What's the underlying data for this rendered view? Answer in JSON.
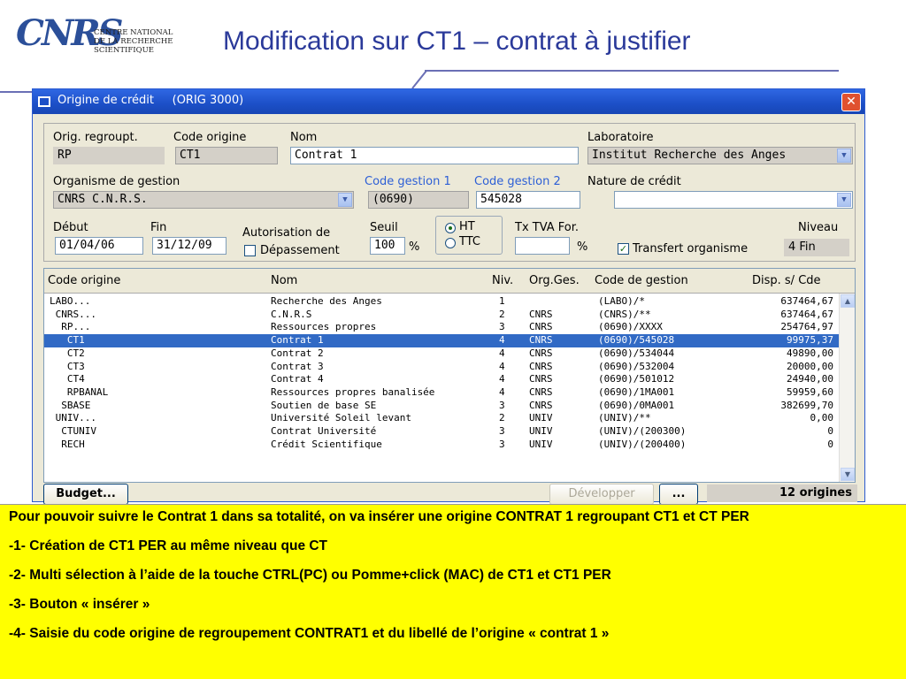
{
  "slide": {
    "title": "Modification sur CT1 – contrat à justifier",
    "logo_text": "CNRS",
    "logo_lines": [
      "CENTRE NATIONAL",
      "DE LA RECHERCHE",
      "SCIENTIFIQUE"
    ]
  },
  "window": {
    "title": "Origine de crédit     (ORIG 3000)",
    "close_glyph": "✕"
  },
  "form": {
    "orig_regroupt": {
      "label": "Orig. regroupt.",
      "value": "RP"
    },
    "code_origine": {
      "label": "Code origine",
      "value": "CT1"
    },
    "nom": {
      "label": "Nom",
      "value": "Contrat 1"
    },
    "laboratoire": {
      "label": "Laboratoire",
      "value": "Institut Recherche des Anges"
    },
    "organisme": {
      "label": "Organisme de gestion",
      "value": "CNRS   C.N.R.S."
    },
    "code_gestion_1": {
      "label": "Code gestion 1",
      "value": "(0690)"
    },
    "code_gestion_2": {
      "label": "Code gestion 2",
      "value": "545028"
    },
    "nature_credit": {
      "label": "Nature de crédit",
      "value": ""
    },
    "debut": {
      "label": "Début",
      "value": "01/04/06"
    },
    "fin": {
      "label": "Fin",
      "value": "31/12/09"
    },
    "autorisation": {
      "label": "Autorisation de",
      "check_label": "Dépassement",
      "checked": false
    },
    "seuil": {
      "label": "Seuil",
      "value": "100",
      "unit": "%"
    },
    "ht_ttc": {
      "ht": "HT",
      "ttc": "TTC",
      "selected": "HT"
    },
    "tva": {
      "label": "Tx TVA For.",
      "value": "",
      "unit": "%"
    },
    "transfert": {
      "label": "Transfert organisme",
      "checked": true
    },
    "niveau": {
      "label": "Niveau",
      "value": "4  Fin"
    }
  },
  "list": {
    "columns": [
      "Code origine",
      "Nom",
      "Niv.",
      "Org.Ges.",
      "Code de gestion",
      "Disp. s/ Cde"
    ],
    "rows": [
      {
        "code": "LABO...",
        "nom": "Recherche des Anges",
        "niv": "1",
        "org": "",
        "cg": "(LABO)/*",
        "disp": "637464,67"
      },
      {
        "code": " CNRS...",
        "nom": "C.N.R.S",
        "niv": "2",
        "org": "CNRS",
        "cg": "(CNRS)/**",
        "disp": "637464,67"
      },
      {
        "code": "  RP...",
        "nom": "Ressources propres",
        "niv": "3",
        "org": "CNRS",
        "cg": "(0690)/XXXX",
        "disp": "254764,97"
      },
      {
        "code": "   CT1",
        "nom": "Contrat 1",
        "niv": "4",
        "org": "CNRS",
        "cg": "(0690)/545028",
        "disp": "99975,37"
      },
      {
        "code": "   CT2",
        "nom": "Contrat 2",
        "niv": "4",
        "org": "CNRS",
        "cg": "(0690)/534044",
        "disp": "49890,00"
      },
      {
        "code": "   CT3",
        "nom": "Contrat 3",
        "niv": "4",
        "org": "CNRS",
        "cg": "(0690)/532004",
        "disp": "20000,00"
      },
      {
        "code": "   CT4",
        "nom": "Contrat 4",
        "niv": "4",
        "org": "CNRS",
        "cg": "(0690)/501012",
        "disp": "24940,00"
      },
      {
        "code": "   RPBANAL",
        "nom": "Ressources propres banalisée",
        "niv": "4",
        "org": "CNRS",
        "cg": "(0690)/1MA001",
        "disp": "59959,60"
      },
      {
        "code": "  SBASE",
        "nom": "Soutien de base SE",
        "niv": "3",
        "org": "CNRS",
        "cg": "(0690)/0MA001",
        "disp": "382699,70"
      },
      {
        "code": " UNIV...",
        "nom": "Université Soleil levant",
        "niv": "2",
        "org": "UNIV",
        "cg": "(UNIV)/**",
        "disp": "0,00"
      },
      {
        "code": "  CTUNIV",
        "nom": "Contrat Université",
        "niv": "3",
        "org": "UNIV",
        "cg": "(UNIV)/(200300)",
        "disp": "0"
      },
      {
        "code": "  RECH",
        "nom": "Crédit Scientifique",
        "niv": "3",
        "org": "UNIV",
        "cg": "(UNIV)/(200400)",
        "disp": "0"
      }
    ],
    "selected_index": 3
  },
  "bottom": {
    "budget_label": "Budget...",
    "developper_label": "Développer",
    "more_label": "...",
    "count": "12 origines"
  },
  "note": {
    "intro": "Pour pouvoir suivre le Contrat 1 dans sa totalité, on va insérer une origine CONTRAT 1 regroupant CT1 et CT PER",
    "items": [
      "-1-  Création de CT1 PER au même niveau que CT",
      "-2- Multi sélection à l’aide de la touche CTRL(PC) ou Pomme+click (MAC) de CT1 et CT1 PER",
      "-3- Bouton « insérer »",
      "-4- Saisie du code origine de regroupement  CONTRAT1 et du libellé de l’origine « contrat 1 »"
    ]
  },
  "colors": {
    "title": "#2b3a9a",
    "titlebar": "#1c4fc7",
    "selection": "#316ac5",
    "note_bg": "#ffff00",
    "label_blue": "#2d5fd6"
  }
}
